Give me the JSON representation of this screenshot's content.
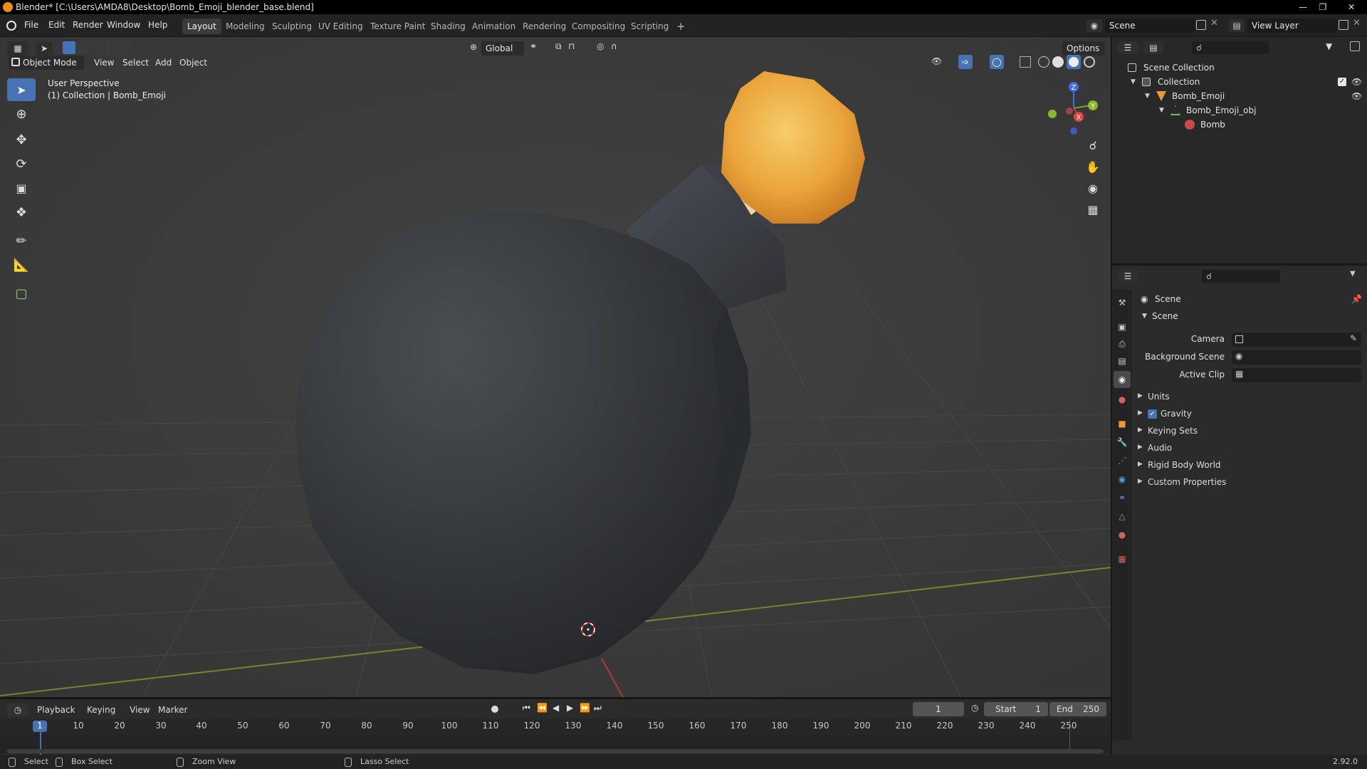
{
  "window": {
    "title": "Blender* [C:\\Users\\AMDA8\\Desktop\\Bomb_Emoji_blender_base.blend]"
  },
  "menubar": {
    "menus": [
      "File",
      "Edit",
      "Render",
      "Window",
      "Help"
    ],
    "workspaces": [
      "Layout",
      "Modeling",
      "Sculpting",
      "UV Editing",
      "Texture Paint",
      "Shading",
      "Animation",
      "Rendering",
      "Compositing",
      "Scripting"
    ],
    "active_workspace": "Layout",
    "add_tab": "+",
    "scene_name": "Scene",
    "view_layer_name": "View Layer"
  },
  "viewport": {
    "transform_orientation": "Global",
    "options_label": "Options",
    "mode_label": "Object Mode",
    "header_menus": [
      "View",
      "Select",
      "Add",
      "Object"
    ],
    "overlay_line1": "User Perspective",
    "overlay_line2": "(1) Collection | Bomb_Emoji",
    "gizmo_labels": {
      "z": "Z",
      "x": "X",
      "y": "Y"
    }
  },
  "outliner": {
    "root": "Scene Collection",
    "items": [
      "Collection",
      "Bomb_Emoji",
      "Bomb_Emoji_obj",
      "Bomb"
    ]
  },
  "properties": {
    "context": "Scene",
    "panel_title": "Scene",
    "fields": [
      {
        "label": "Camera",
        "value": ""
      },
      {
        "label": "Background Scene",
        "value": ""
      },
      {
        "label": "Active Clip",
        "value": ""
      }
    ],
    "subpanels": [
      "Units",
      "Gravity",
      "Keying Sets",
      "Audio",
      "Rigid Body World",
      "Custom Properties"
    ],
    "gravity_checked": true
  },
  "timeline": {
    "menus": [
      "Playback",
      "Keying",
      "View",
      "Marker"
    ],
    "current_frame": "1",
    "start_label": "Start",
    "start_value": "1",
    "end_label": "End",
    "end_value": "250",
    "ruler": [
      "1",
      "10",
      "20",
      "30",
      "40",
      "50",
      "60",
      "70",
      "80",
      "90",
      "100",
      "110",
      "120",
      "130",
      "140",
      "150",
      "160",
      "170",
      "180",
      "190",
      "200",
      "210",
      "220",
      "230",
      "240",
      "250"
    ]
  },
  "statusbar": {
    "items": [
      "Select",
      "Box Select",
      "Zoom View",
      "Lasso Select"
    ],
    "version": "2.92.0"
  },
  "colors": {
    "accent": "#4772b3",
    "fuse": "#f2a53a",
    "bomb": "#3a3d40"
  }
}
